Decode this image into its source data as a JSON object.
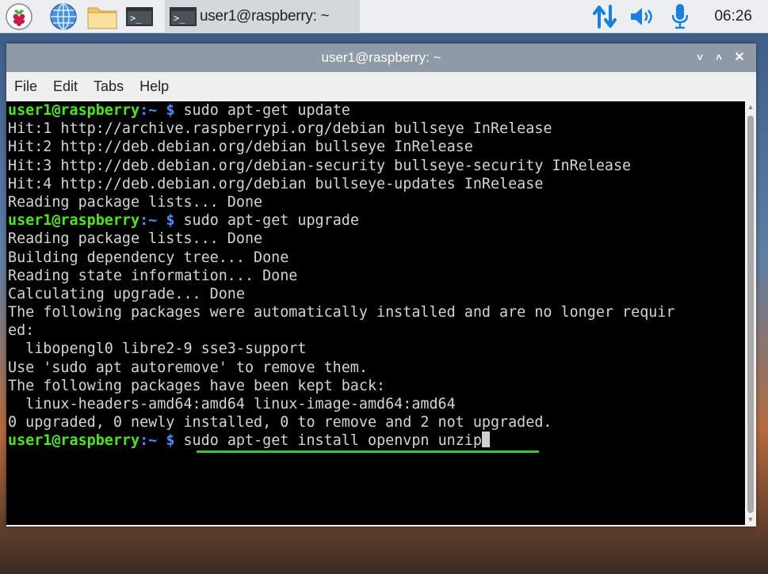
{
  "taskbar": {
    "task_title": "user1@raspberry: ~",
    "terminal_glyph": ">_",
    "clock": "06:26",
    "icons": [
      "raspberry-pi-menu-icon",
      "globe-icon",
      "folder-icon",
      "terminal-icon",
      "network-arrows-icon",
      "volume-icon",
      "microphone-icon"
    ]
  },
  "window": {
    "title": "user1@raspberry: ~",
    "controls": {
      "minimize": "˅",
      "maximize": "˄",
      "close": "✕"
    },
    "menu": [
      "File",
      "Edit",
      "Tabs",
      "Help"
    ]
  },
  "terminal": {
    "prompt": {
      "user_host": "user1@raspberry",
      "path": ":~",
      "symbol": " $"
    },
    "lines": [
      {
        "kind": "cmd",
        "text": " sudo apt-get update"
      },
      {
        "kind": "out",
        "text": "Hit:1 http://archive.raspberrypi.org/debian bullseye InRelease"
      },
      {
        "kind": "out",
        "text": "Hit:2 http://deb.debian.org/debian bullseye InRelease"
      },
      {
        "kind": "out",
        "text": "Hit:3 http://deb.debian.org/debian-security bullseye-security InRelease"
      },
      {
        "kind": "out",
        "text": "Hit:4 http://deb.debian.org/debian bullseye-updates InRelease"
      },
      {
        "kind": "out",
        "text": "Reading package lists... Done"
      },
      {
        "kind": "cmd",
        "text": " sudo apt-get upgrade"
      },
      {
        "kind": "out",
        "text": "Reading package lists... Done"
      },
      {
        "kind": "out",
        "text": "Building dependency tree... Done"
      },
      {
        "kind": "out",
        "text": "Reading state information... Done"
      },
      {
        "kind": "out",
        "text": "Calculating upgrade... Done"
      },
      {
        "kind": "out",
        "text": "The following packages were automatically installed and are no longer requir"
      },
      {
        "kind": "out",
        "text": "ed:"
      },
      {
        "kind": "out",
        "text": "  libopengl0 libre2-9 sse3-support"
      },
      {
        "kind": "out",
        "text": "Use 'sudo apt autoremove' to remove them."
      },
      {
        "kind": "out",
        "text": "The following packages have been kept back:"
      },
      {
        "kind": "out",
        "text": "  linux-headers-amd64:amd64 linux-image-amd64:amd64"
      },
      {
        "kind": "out",
        "text": "0 upgraded, 0 newly installed, 0 to remove and 2 not upgraded."
      },
      {
        "kind": "cmd",
        "text": " sudo apt-get install openvpn unzip",
        "current": true
      }
    ]
  },
  "colors": {
    "prompt_user": "#4ee61a",
    "prompt_path": "#4f8bff",
    "input_underline": "#35c535",
    "titlebar": "#8e9aa6"
  }
}
